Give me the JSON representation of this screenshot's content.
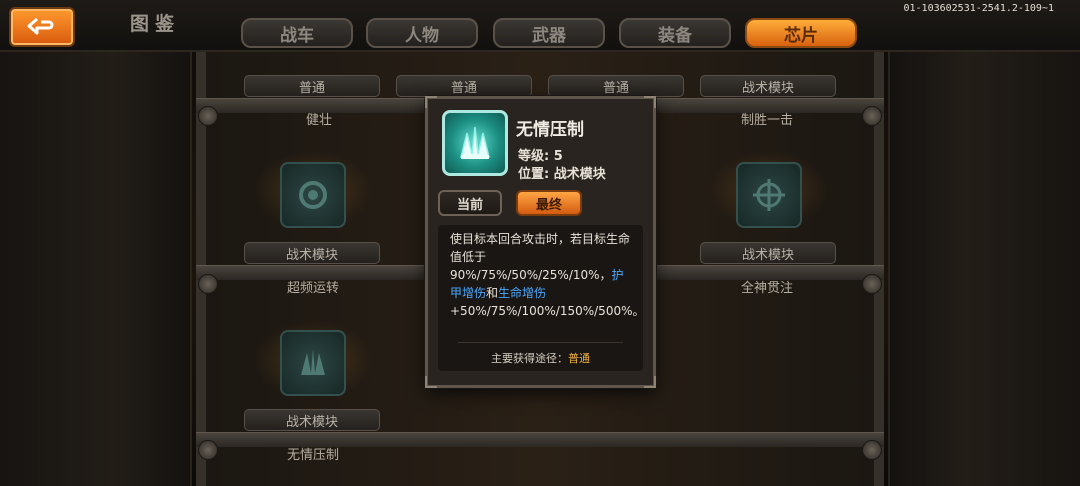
{
  "top": {
    "title": "图鉴",
    "build": "01-103602531-2541.2-109~1",
    "tabs": [
      "战车",
      "人物",
      "武器",
      "装备",
      "芯片"
    ],
    "active_tab": "芯片"
  },
  "grid": {
    "row0_labels": [
      "普通",
      "普通",
      "普通",
      "战术模块"
    ],
    "row0_names": [
      "健壮",
      "制胜一击"
    ],
    "row1_labels": [
      "战术模块",
      "战术模块"
    ],
    "row1_names": [
      "超频运转",
      "全神贯注"
    ],
    "row2_labels": [
      "战术模块"
    ],
    "row2_names": [
      "无情压制"
    ]
  },
  "popup": {
    "name": "无情压制",
    "level": "等级: 5",
    "position": "位置: 战术模块",
    "btn_current": "当前",
    "btn_final": "最终",
    "desc_1": "使目标本回合攻击时，若目标生命值低于90%/75%/50%/25%/10%，",
    "desc_blue1": "护甲增伤",
    "desc_and": "和",
    "desc_blue2": "生命增伤",
    "desc_2": "+50%/75%/100%/150%/500%。",
    "source_label": "主要获得途径：",
    "source_value": "普通"
  },
  "colors": {
    "accent": "#ff9a2e",
    "highlight": "#4aa8ff",
    "source": "#f3b23d"
  }
}
